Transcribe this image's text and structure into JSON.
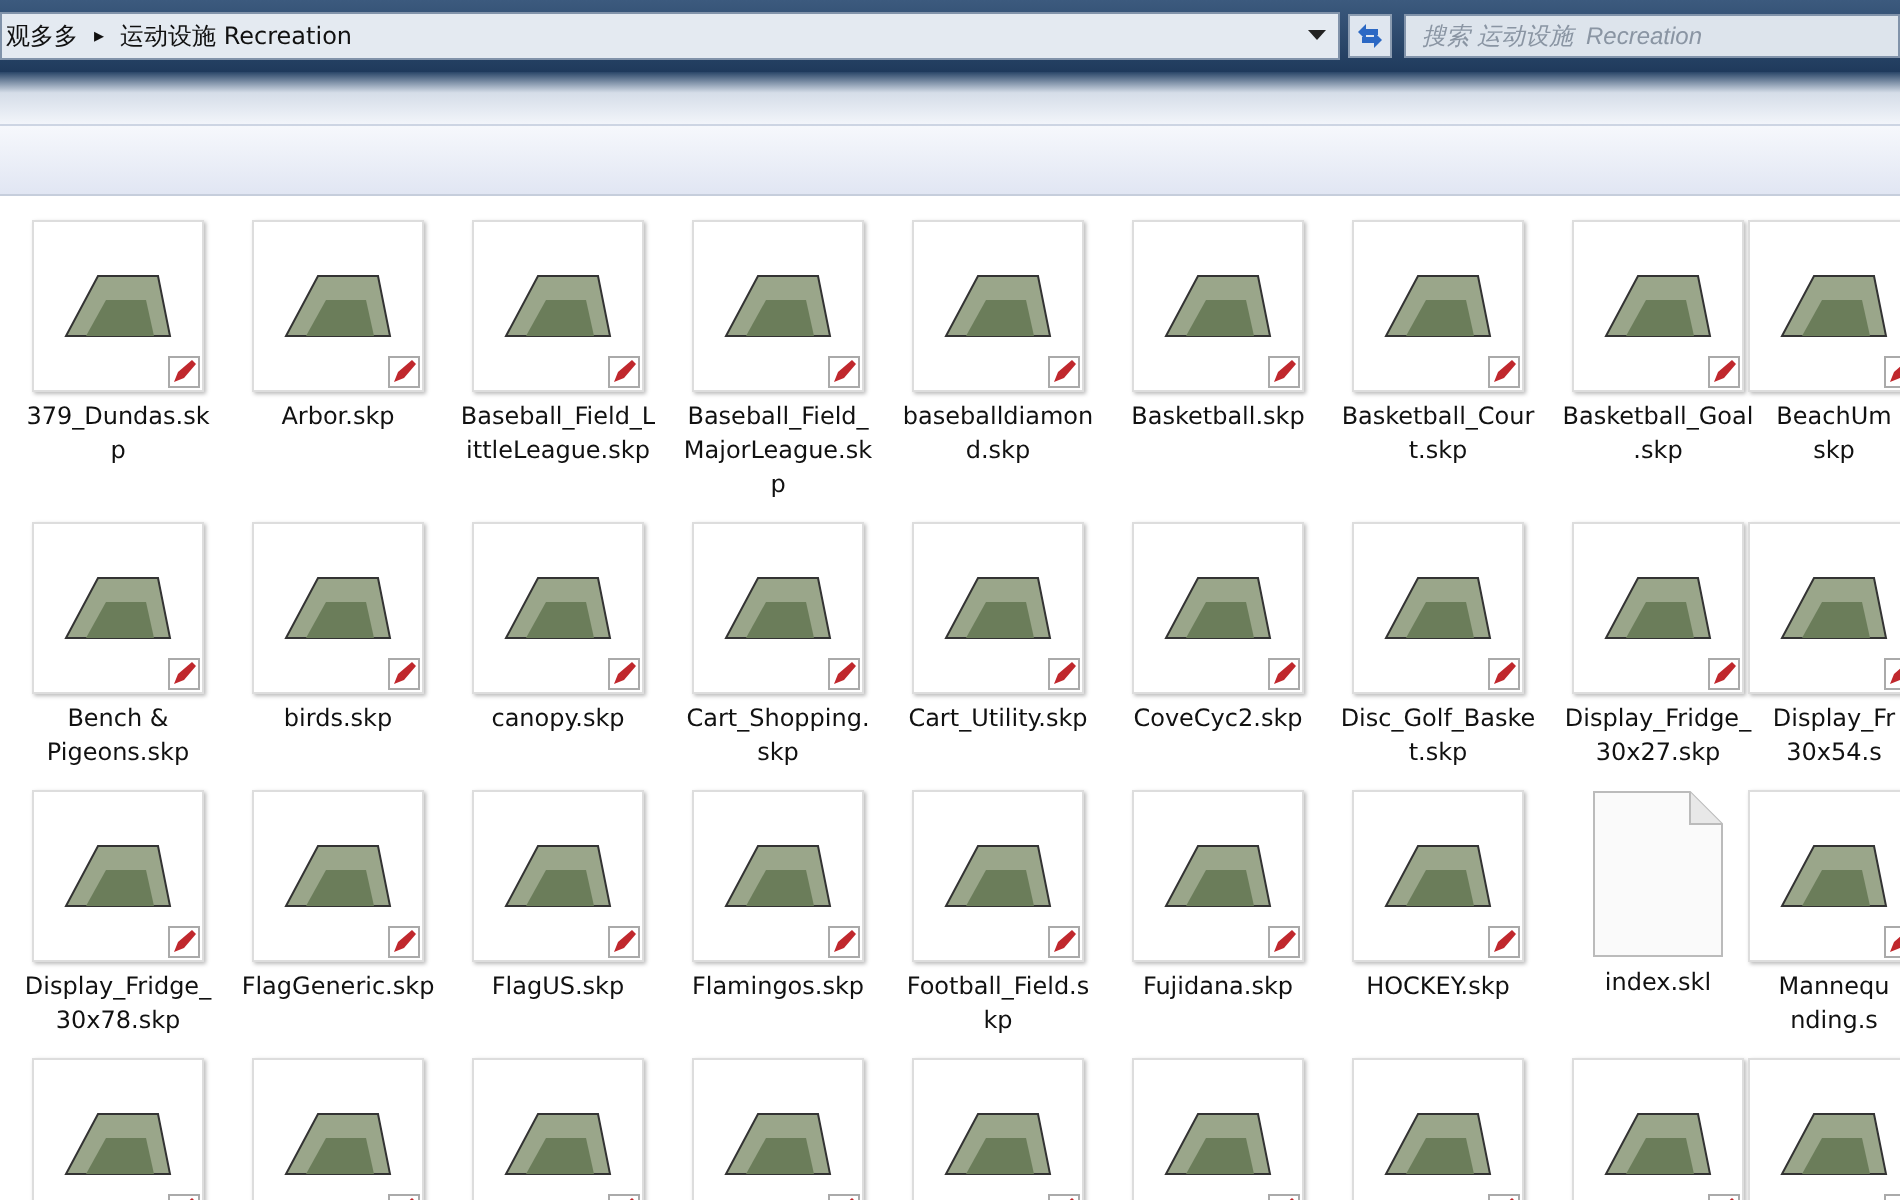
{
  "address_bar": {
    "crumbs": [
      "观多多",
      "运动设施  Recreation"
    ],
    "separator": "▸"
  },
  "search": {
    "placeholder": "搜索 运动设施  Recreation"
  },
  "files": [
    {
      "kind": "model",
      "lines": [
        "379_Dundas.sk",
        "p"
      ]
    },
    {
      "kind": "model",
      "lines": [
        "Arbor.skp"
      ]
    },
    {
      "kind": "model",
      "lines": [
        "Baseball_Field_L",
        "ittleLeague.skp"
      ]
    },
    {
      "kind": "model",
      "lines": [
        "Baseball_Field_",
        "MajorLeague.sk",
        "p"
      ]
    },
    {
      "kind": "model",
      "lines": [
        "baseballdiamon",
        "d.skp"
      ]
    },
    {
      "kind": "model",
      "lines": [
        "Basketball.skp"
      ]
    },
    {
      "kind": "model",
      "lines": [
        "Basketball_Cour",
        "t.skp"
      ]
    },
    {
      "kind": "model",
      "lines": [
        "Basketball_Goal",
        ".skp"
      ]
    },
    {
      "kind": "model",
      "lines": [
        "BeachUm",
        "skp"
      ]
    },
    {
      "kind": "model",
      "lines": [
        "Bench &",
        "Pigeons.skp"
      ]
    },
    {
      "kind": "model",
      "lines": [
        "birds.skp"
      ]
    },
    {
      "kind": "model",
      "lines": [
        "canopy.skp"
      ]
    },
    {
      "kind": "model",
      "lines": [
        "Cart_Shopping.",
        "skp"
      ]
    },
    {
      "kind": "model",
      "lines": [
        "Cart_Utility.skp"
      ]
    },
    {
      "kind": "model",
      "lines": [
        "CoveCyc2.skp"
      ]
    },
    {
      "kind": "model",
      "lines": [
        "Disc_Golf_Baske",
        "t.skp"
      ]
    },
    {
      "kind": "model",
      "lines": [
        "Display_Fridge_",
        "30x27.skp"
      ]
    },
    {
      "kind": "model",
      "lines": [
        "Display_Fr",
        "30x54.s"
      ]
    },
    {
      "kind": "model",
      "lines": [
        "Display_Fridge_",
        "30x78.skp"
      ]
    },
    {
      "kind": "model",
      "lines": [
        "FlagGeneric.skp"
      ]
    },
    {
      "kind": "model",
      "lines": [
        "FlagUS.skp"
      ]
    },
    {
      "kind": "model",
      "lines": [
        "Flamingos.skp"
      ]
    },
    {
      "kind": "model",
      "lines": [
        "Football_Field.s",
        "kp"
      ]
    },
    {
      "kind": "model",
      "lines": [
        "Fujidana.skp"
      ]
    },
    {
      "kind": "model",
      "lines": [
        "HOCKEY.skp"
      ]
    },
    {
      "kind": "document",
      "lines": [
        "index.skl"
      ]
    },
    {
      "kind": "model",
      "lines": [
        "Mannequ",
        "nding.s"
      ]
    },
    {
      "kind": "model"
    },
    {
      "kind": "model"
    },
    {
      "kind": "model"
    },
    {
      "kind": "model"
    },
    {
      "kind": "model"
    },
    {
      "kind": "model"
    },
    {
      "kind": "model"
    },
    {
      "kind": "model"
    },
    {
      "kind": "model"
    }
  ]
}
